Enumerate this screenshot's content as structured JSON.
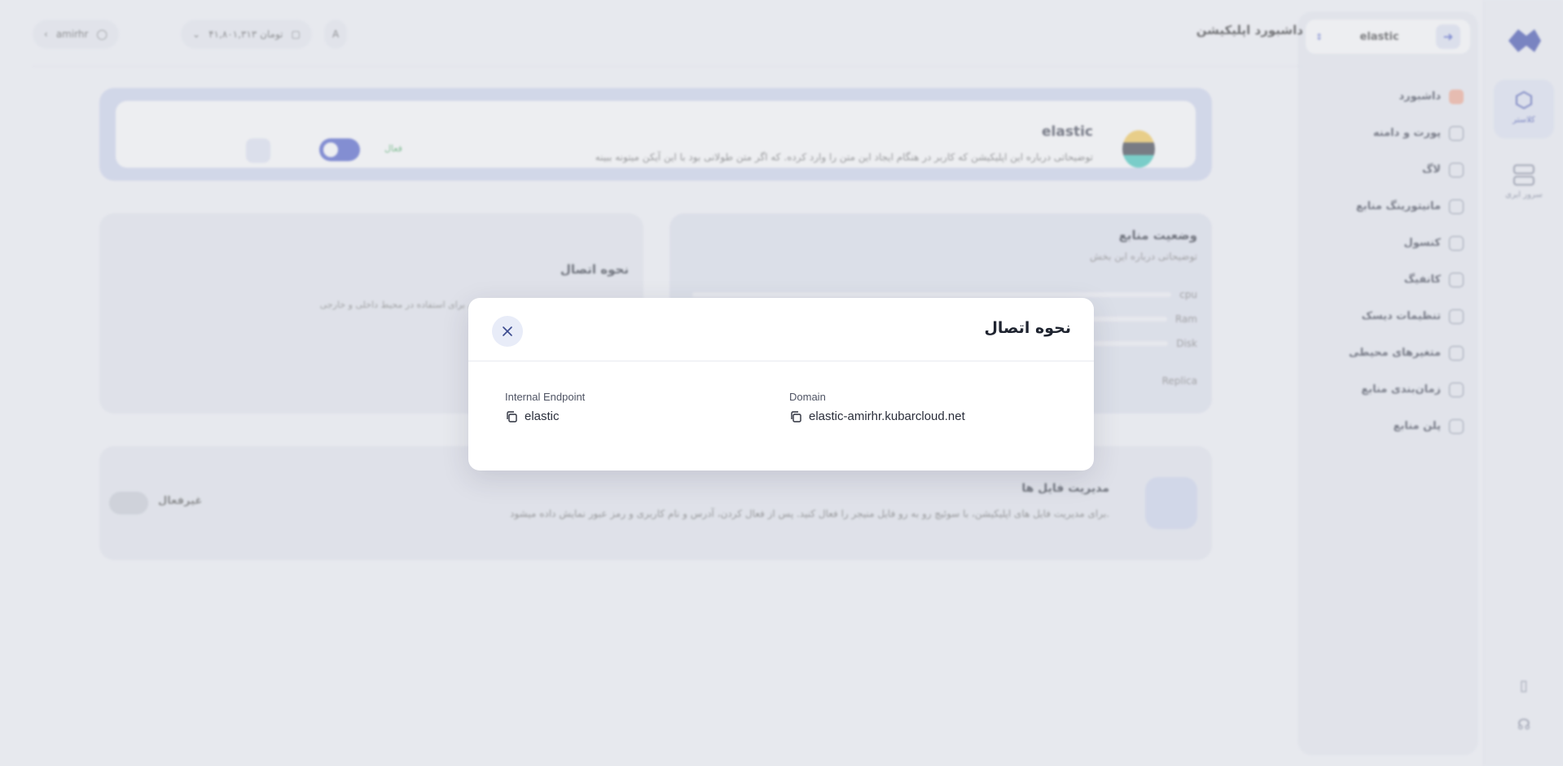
{
  "rail": {
    "items": [
      {
        "label": "کلاستر",
        "icon": "cube-icon"
      },
      {
        "label": "سرور ابری",
        "icon": "server-icon"
      }
    ],
    "bottom_icons": [
      "tablet-icon",
      "headset-icon"
    ]
  },
  "sidebar": {
    "app_selector": {
      "value": "elastic"
    },
    "items": [
      {
        "label": "داشبورد",
        "icon": "dashboard-icon"
      },
      {
        "label": "پورت و دامنه",
        "icon": "globe-icon"
      },
      {
        "label": "لاگ",
        "icon": "file-icon"
      },
      {
        "label": "مانیتورینگ منابع",
        "icon": "monitor-search-icon"
      },
      {
        "label": "کنسول",
        "icon": "terminal-icon"
      },
      {
        "label": "کانفیگ",
        "icon": "gear-icon"
      },
      {
        "label": "تنظیمات دیسک",
        "icon": "disk-icon"
      },
      {
        "label": "متغیرهای محیطی",
        "icon": "variables-icon"
      },
      {
        "label": "زمان‌بندی منابع",
        "icon": "clock-icon"
      },
      {
        "label": "پلن منابع",
        "icon": "plan-icon"
      }
    ]
  },
  "topbar": {
    "title": "داشبورد اپلیکیشن",
    "balance": "۴۱,۸۰۱,۳۱۳ تومان",
    "username": "amirhr"
  },
  "app_card": {
    "name": "elastic",
    "description": "توضیحاتی درباره این اپلیکیشن که کاربر در هنگام ایجاد این متن را وارد کرده. که اگر متن طولانی بود با این آیکن میتونه ببینه",
    "status": "فعال"
  },
  "resources": {
    "title": "وضعیت منابع",
    "subtitle": "توضیحاتی درباره این بخش",
    "rows": [
      {
        "label": "cpu"
      },
      {
        "label": "Ram"
      },
      {
        "label": "Disk"
      },
      {
        "label": "Replica"
      }
    ]
  },
  "connection_card": {
    "title": "نحوه اتصال",
    "description": "ان آدرس‌ها، پورت‌ها و شناسه‌های دسترسی برای استفاده در محیط داخلی و خارجی"
  },
  "files_card": {
    "title": "مدیریت فایل ها",
    "description": "برای مدیریت فایل های اپلیکیشن، با سوئیچ رو به رو فایل منیجر را فعال کنید. پس از فعال کردن، آدرس و نام کاربری و رمز عبور نمایش داده میشود.",
    "status": "غیرفعال"
  },
  "modal": {
    "title": "نحوه اتصال",
    "domain_label": "Domain",
    "domain_value": "elastic-amirhr.kubarcloud.net",
    "internal_label": "Internal Endpoint",
    "internal_value": "elastic"
  }
}
